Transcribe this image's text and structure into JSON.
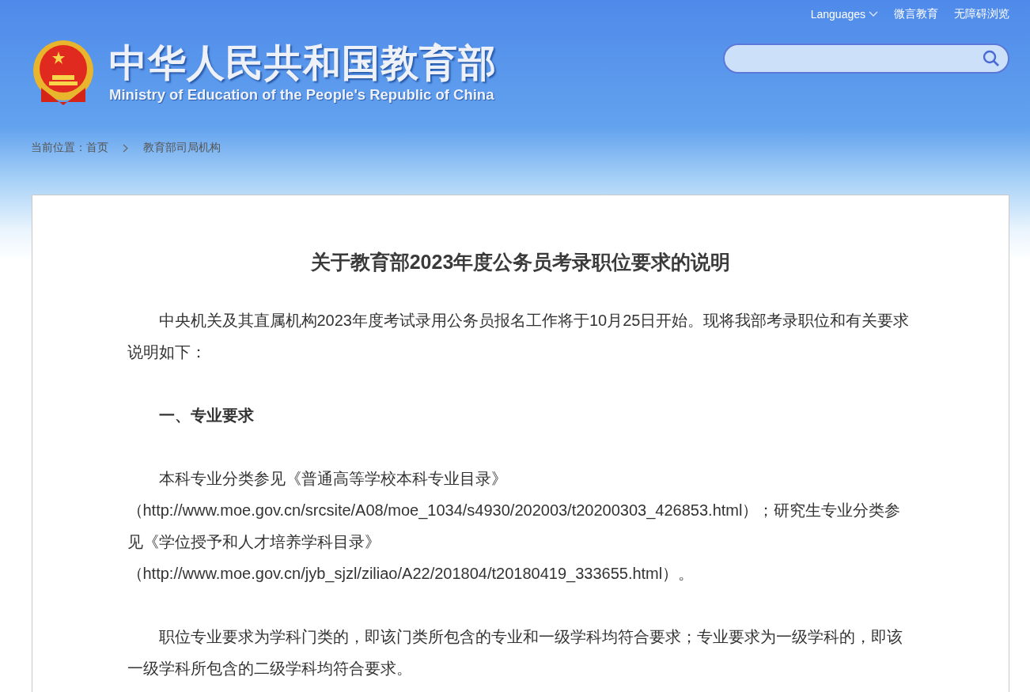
{
  "top_links": [
    {
      "kind": "dropdown",
      "label": "Languages"
    },
    {
      "kind": "link",
      "label": "微言教育"
    },
    {
      "kind": "link",
      "label": "无障碍浏览"
    }
  ],
  "header": {
    "title": "中华人民共和国教育部",
    "subtitle": "Ministry of Education of the People's Republic of China"
  },
  "search": {
    "kind": "rounded"
  },
  "breadcrumb": {
    "label": "当前位置：",
    "items": [
      "首页",
      "教育部司局机构"
    ]
  },
  "article": {
    "title": "关于教育部2023年度公务员考录职位要求的说明",
    "paragraphs": [
      {
        "kind": "text",
        "text": "中央机关及其直属机构2023年度考试录用公务员报名工作将于10月25日开始。现将我部考录职位和有关要求说明如下："
      },
      {
        "kind": "heading",
        "text": "一、专业要求"
      },
      {
        "kind": "text",
        "text": "本科专业分类参见《普通高等学校本科专业目录》（http://www.moe.gov.cn/srcsite/A08/moe_1034/s4930/202003/t20200303_426853.html）；研究生专业分类参见《学位授予和人才培养学科目录》（http://www.moe.gov.cn/jyb_sjzl/ziliao/A22/201804/t20180419_333655.html）。"
      },
      {
        "kind": "text",
        "text": "职位专业要求为学科门类的，即该门类所包含的专业和一级学科均符合要求；专业要求为一级学科的，即该一级学科所包含的二级学科均符合要求。"
      }
    ]
  }
}
